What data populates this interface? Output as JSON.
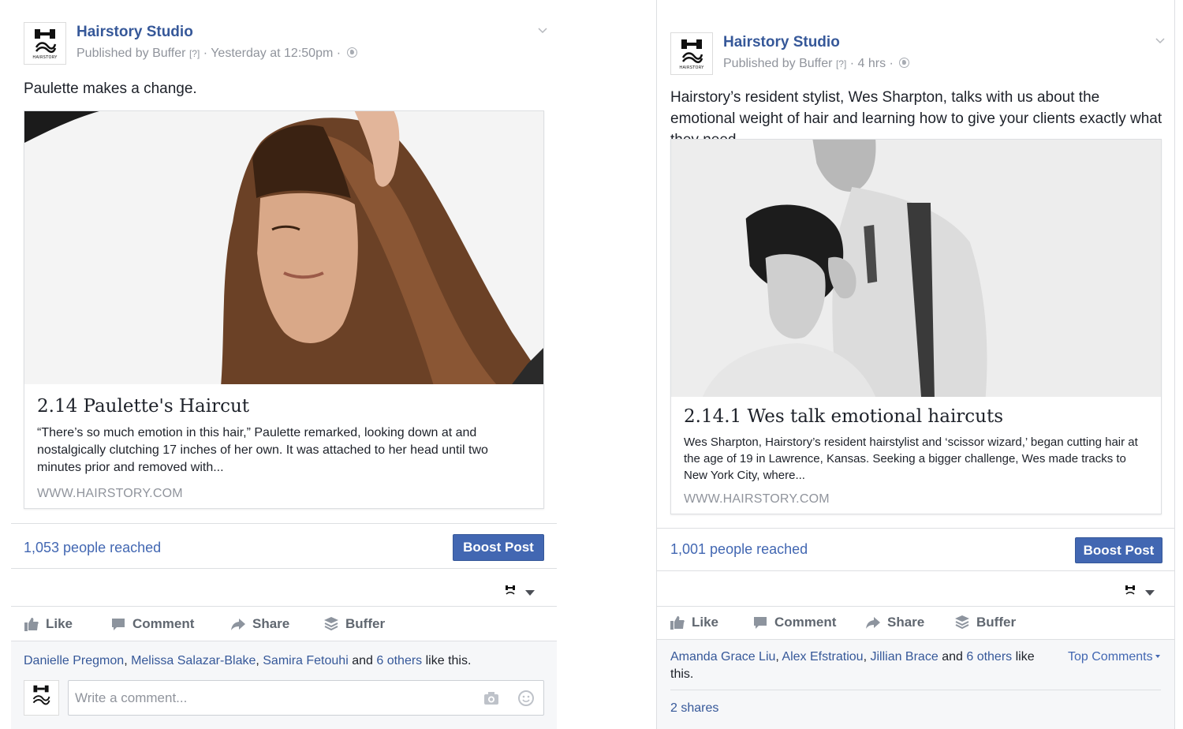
{
  "posts": [
    {
      "page_name": "Hairstory Studio",
      "logo_text": "HAIRSTORY",
      "published_prefix": "Published by",
      "publisher": "Buffer",
      "help_marker": "[?]",
      "timestamp": "· Yesterday at 12:50pm ·",
      "message": "Paulette makes a change.",
      "card": {
        "title": "2.14 Paulette's Haircut",
        "description": "“There’s so much emotion in this hair,” Paulette remarked, looking down at and nostalgically clutching 17 inches of her own. It was attached to her head until two minutes prior and removed with...",
        "domain": "WWW.HAIRSTORY.COM"
      },
      "reach": "1,053 people reached",
      "boost_label": "Boost Post",
      "actions": {
        "like": "Like",
        "comment": "Comment",
        "share": "Share",
        "buffer": "Buffer"
      },
      "likers": [
        "Danielle Pregmon",
        "Melissa Salazar-Blake",
        "Samira Fetouhi"
      ],
      "likes_and": "and",
      "likes_others": "6 others",
      "likes_suffix": "like this.",
      "comment_placeholder": "Write a comment..."
    },
    {
      "page_name": "Hairstory Studio",
      "logo_text": "HAIRSTORY",
      "published_prefix": "Published by",
      "publisher": "Buffer",
      "help_marker": "[?]",
      "timestamp": "· 4 hrs ·",
      "message": "Hairstory’s resident stylist, Wes Sharpton, talks with us about the emotional weight of hair and learning how to give your clients exactly what they need.",
      "card": {
        "title": "2.14.1 Wes talk emotional haircuts",
        "description": "Wes Sharpton, Hairstory’s resident hairstylist and ‘scissor wizard,’ began cutting hair at the age of 19 in Lawrence, Kansas. Seeking a bigger challenge, Wes made tracks to New York City, where...",
        "domain": "WWW.HAIRSTORY.COM"
      },
      "reach": "1,001 people reached",
      "boost_label": "Boost Post",
      "actions": {
        "like": "Like",
        "comment": "Comment",
        "share": "Share",
        "buffer": "Buffer"
      },
      "likers": [
        "Amanda Grace Liu",
        "Alex Efstratiou",
        "Jillian Brace"
      ],
      "likes_and": "and",
      "likes_others": "6 others",
      "likes_suffix": "like this.",
      "top_comments": "Top Comments",
      "shares": "2 shares"
    }
  ],
  "icons": [
    "chevron-down-icon",
    "globe-icon",
    "like-icon",
    "comment-icon",
    "share-icon",
    "buffer-icon",
    "camera-icon",
    "emoji-icon",
    "caret-down-icon"
  ],
  "colors": {
    "link": "#365899",
    "accent": "#4267b2",
    "meta": "#90949c",
    "action": "#606770",
    "border": "#dddfe2"
  }
}
